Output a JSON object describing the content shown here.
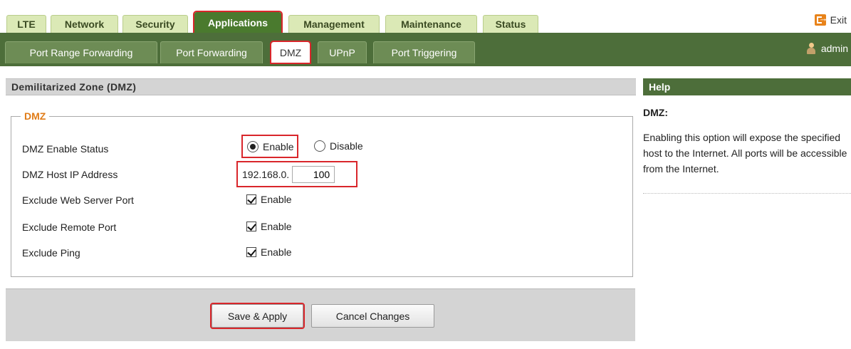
{
  "top_tabs": [
    "LTE",
    "Network",
    "Security",
    "Applications",
    "Management",
    "Maintenance",
    "Status"
  ],
  "exit_label": "Exit",
  "sub_tabs": [
    "Port Range Forwarding",
    "Port Forwarding",
    "DMZ",
    "UPnP",
    "Port Triggering"
  ],
  "user": "admin",
  "section": {
    "title": "Demilitarized Zone (DMZ)",
    "legend": "DMZ",
    "rows": {
      "enable_status": {
        "label": "DMZ Enable Status",
        "options": [
          "Enable",
          "Disable"
        ],
        "selected": "Enable"
      },
      "host_ip": {
        "label": "DMZ Host IP Address",
        "prefix": "192.168.0.",
        "value": "100"
      },
      "exclude_web": {
        "label": "Exclude Web Server Port",
        "option": "Enable",
        "checked": true
      },
      "exclude_remote": {
        "label": "Exclude Remote Port",
        "option": "Enable",
        "checked": true
      },
      "exclude_ping": {
        "label": "Exclude Ping",
        "option": "Enable",
        "checked": true
      }
    }
  },
  "buttons": {
    "save": "Save & Apply",
    "cancel": "Cancel Changes"
  },
  "help": {
    "header": "Help",
    "title": "DMZ:",
    "body": "Enabling this option will expose the specified host to the Internet. All ports will be accessible from the Internet."
  },
  "colors": {
    "accent": "#4d6e3a",
    "highlight": "#d9262b",
    "legend": "#e07c18"
  }
}
